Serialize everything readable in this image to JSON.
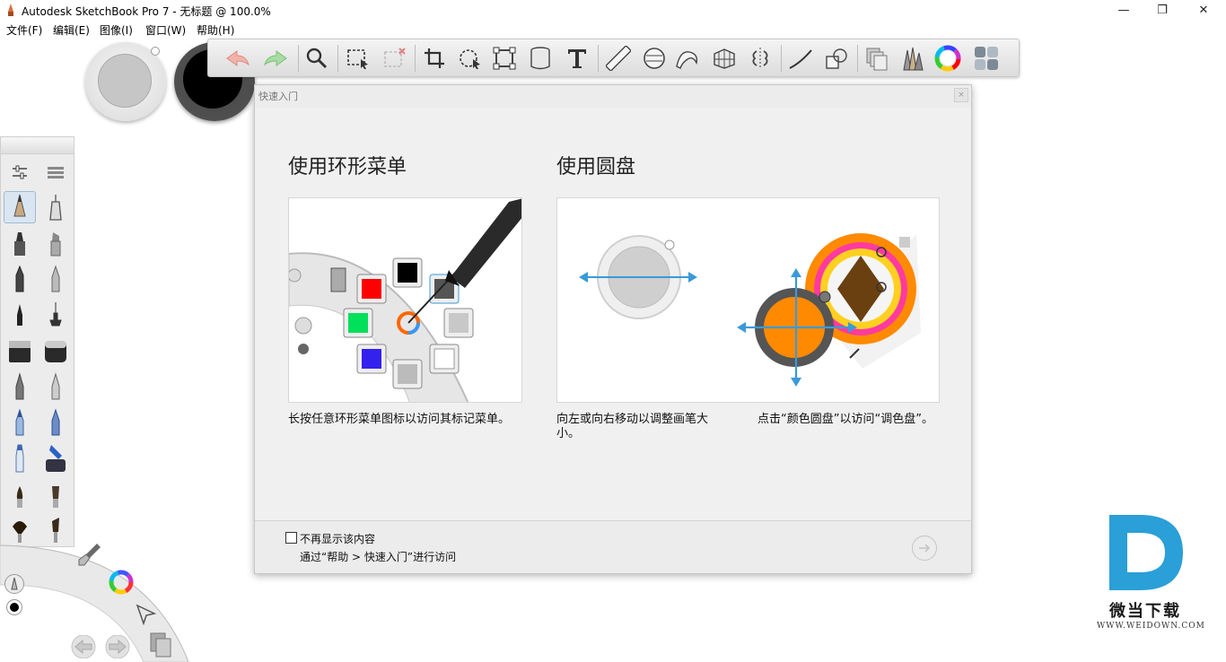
{
  "window": {
    "title": "Autodesk SketchBook Pro 7 - 无标题 @ 100.0%",
    "minimize_glyph": "—",
    "maximize_glyph": "❐",
    "close_glyph": "✕"
  },
  "menu": {
    "items": [
      {
        "label": "文件(F)"
      },
      {
        "label": "编辑(E)"
      },
      {
        "label": "图像(I)"
      },
      {
        "label": "窗口(W)"
      },
      {
        "label": "帮助(H)"
      }
    ]
  },
  "toolbar": {
    "tools": [
      "undo-icon",
      "redo-icon",
      "zoom-icon",
      "select-rect-icon",
      "select-lasso-icon",
      "crop-icon",
      "transform-icon",
      "distort-icon",
      "fill-icon",
      "text-icon",
      "ruler-icon",
      "ellipse-icon",
      "french-curve-icon",
      "perspective-icon",
      "symmetry-icon",
      "stroke-icon",
      "shape-icon",
      "layers-icon",
      "brushes-icon",
      "color-wheel-icon",
      "copic-palette-icon"
    ]
  },
  "dialog": {
    "title": "快速入门",
    "close_glyph": "×",
    "section1": {
      "heading": "使用环形菜单",
      "caption": "长按任意环形菜单图标以访问其标记菜单。"
    },
    "section2": {
      "heading": "使用圆盘",
      "caption_left": "向左或向右移动以调整画笔大小。",
      "caption_right": "点击“颜色圆盘”以访问“调色盘”。"
    },
    "footer": {
      "checkbox_label": "不再显示该内容",
      "hint": "通过“帮助 > 快速入门”进行访问"
    }
  },
  "colors": {
    "accent_blue": "#3a9ad9",
    "puck_orange": "#ff8a00",
    "watermark_blue": "#2a9fd8"
  },
  "watermark": {
    "text": "微当下载",
    "url": "WWW.WEIDOWN.COM"
  }
}
